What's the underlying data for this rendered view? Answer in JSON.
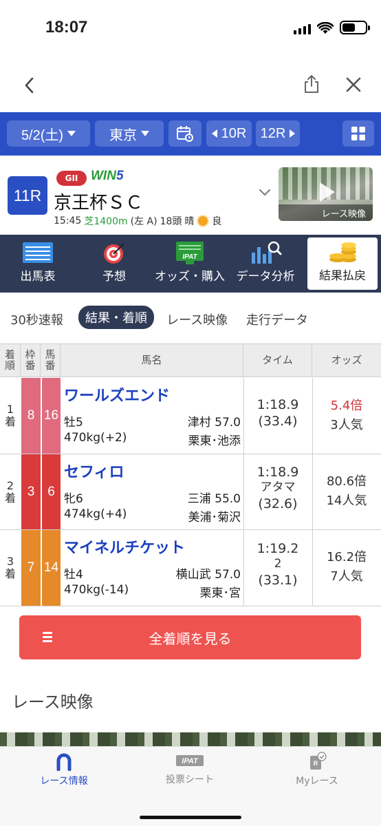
{
  "status": {
    "time": "18:07"
  },
  "header": {
    "date": "5/2(土)",
    "venue": "東京",
    "prev_race": "10R",
    "next_race": "12R"
  },
  "race": {
    "number": "11R",
    "grade": "GII",
    "win5": "WIN5",
    "name": "京王杯ＳＣ",
    "start_time": "15:45",
    "course": "芝1400m",
    "direction": "(左 A)",
    "runners": "18頭",
    "weather": "晴",
    "going": "良",
    "video_caption": "レース映像"
  },
  "tiles": [
    {
      "label": "出馬表",
      "icon": "entry-list-icon"
    },
    {
      "label": "予想",
      "icon": "target-icon"
    },
    {
      "label": "オッズ・購入",
      "icon": "ipat-monitor-icon"
    },
    {
      "label": "データ分析",
      "icon": "chart-magnifier-icon"
    },
    {
      "label": "結果払戻",
      "icon": "coins-icon"
    }
  ],
  "ipat_label": "IPAT",
  "subtabs": [
    "30秒速報",
    "結果・着順",
    "レース映像",
    "走行データ"
  ],
  "table": {
    "headers": {
      "rank": "着順",
      "frame": "枠番",
      "num": "馬番",
      "name": "馬名",
      "time": "タイム",
      "odds": "オッズ"
    },
    "rank_suffix": "着",
    "rows": [
      {
        "rank": "1",
        "frame": "8",
        "frame_color": "#e06b7e",
        "num": "16",
        "name": "ワールズエンド",
        "sex_age": "牡5",
        "jockey_weight": "津村 57.0",
        "body_weight": "470kg(+2)",
        "stable": "栗東･池添",
        "time": "1:18.9",
        "margin": "",
        "last3f": "(33.4)",
        "odds": "5.4倍",
        "popularity": "3人気",
        "fav": true
      },
      {
        "rank": "2",
        "frame": "3",
        "frame_color": "#d93a3a",
        "num": "6",
        "name": "セフィロ",
        "sex_age": "牝6",
        "jockey_weight": "三浦 55.0",
        "body_weight": "474kg(+4)",
        "stable": "美浦･菊沢",
        "time": "1:18.9",
        "margin": "アタマ",
        "last3f": "(32.6)",
        "odds": "80.6倍",
        "popularity": "14人気",
        "fav": false
      },
      {
        "rank": "3",
        "frame": "7",
        "frame_color": "#e58a2a",
        "num": "14",
        "name": "マイネルチケット",
        "sex_age": "牡4",
        "jockey_weight": "横山武 57.0",
        "body_weight": "470kg(-14)",
        "stable": "栗東･宮",
        "time": "1:19.2",
        "margin": "2",
        "last3f": "(33.1)",
        "odds": "16.2倍",
        "popularity": "7人気",
        "fav": false
      }
    ]
  },
  "all_results_button": "全着順を見る",
  "section_title": "レース映像",
  "bottom_tabs": [
    {
      "label": "レース情報",
      "icon": "horseshoe-icon"
    },
    {
      "label": "投票シート",
      "icon": "ipat-icon"
    },
    {
      "label": "Myレース",
      "icon": "my-race-icon"
    }
  ],
  "colors": {
    "brand_blue": "#2a4fc4",
    "nav_dark": "#2f3a56",
    "button_red": "#ef5350",
    "odds_red": "#d3323a"
  }
}
